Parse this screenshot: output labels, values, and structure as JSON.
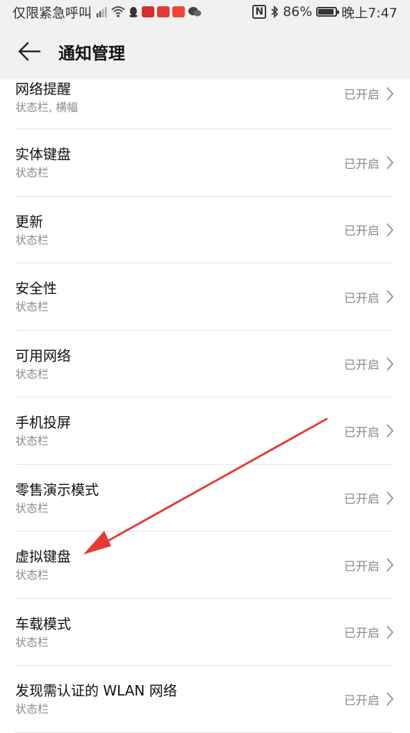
{
  "status_bar": {
    "carrier_text": "仅限紧急呼叫",
    "battery_text": "86%",
    "time": "晚上7:47",
    "nfc_label": "N"
  },
  "header": {
    "title": "通知管理"
  },
  "colors": {
    "accent_arrow": "#e53935",
    "divider": "#e3e3e3",
    "header_bg": "#f1f1f1"
  },
  "list": {
    "items": [
      {
        "title": "网络提醒",
        "subtitle": "状态栏, 横幅",
        "status": "已开启"
      },
      {
        "title": "实体键盘",
        "subtitle": "状态栏",
        "status": "已开启"
      },
      {
        "title": "更新",
        "subtitle": "状态栏",
        "status": "已开启"
      },
      {
        "title": "安全性",
        "subtitle": "状态栏",
        "status": "已开启"
      },
      {
        "title": "可用网络",
        "subtitle": "状态栏",
        "status": "已开启"
      },
      {
        "title": "手机投屏",
        "subtitle": "状态栏",
        "status": "已开启"
      },
      {
        "title": "零售演示模式",
        "subtitle": "状态栏",
        "status": "已开启"
      },
      {
        "title": "虚拟键盘",
        "subtitle": "状态栏",
        "status": "已开启"
      },
      {
        "title": "车载模式",
        "subtitle": "状态栏",
        "status": "已开启"
      },
      {
        "title": "发现需认证的 WLAN 网络",
        "subtitle": "状态栏",
        "status": "已开启"
      }
    ]
  }
}
